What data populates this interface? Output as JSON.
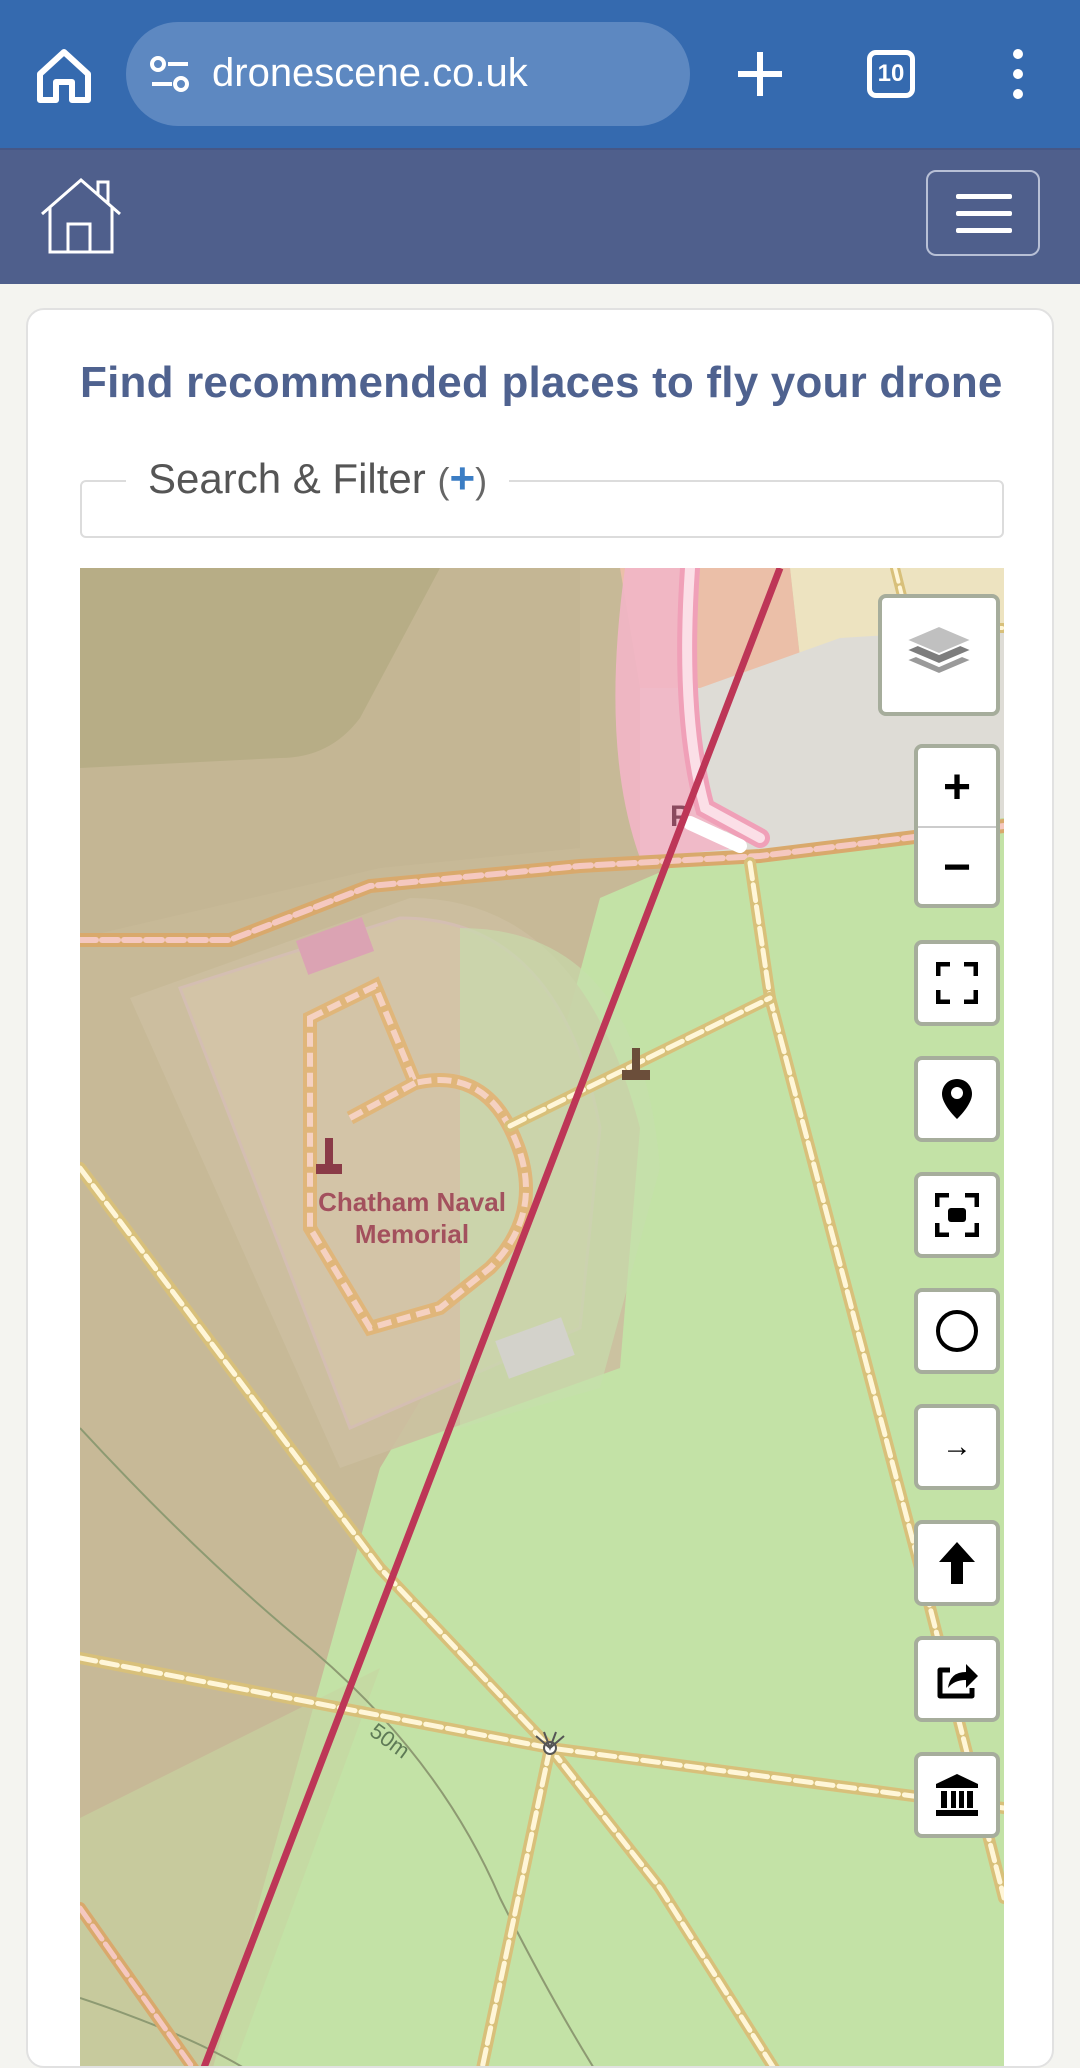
{
  "browser": {
    "url": "dronescene.co.uk",
    "tab_count": "10",
    "icons": [
      "home-icon",
      "site-settings-icon",
      "new-tab-icon",
      "tab-switcher-icon",
      "more-options-icon"
    ]
  },
  "site_nav": {
    "icons": [
      "home-outline-icon",
      "hamburger-menu-icon"
    ]
  },
  "page": {
    "title": "Find recommended places to fly your drone",
    "filter": {
      "label": "Search & Filter",
      "paren_open": "(",
      "toggle": "+",
      "paren_close": ")"
    }
  },
  "map": {
    "place_label_line1": "Chatham Naval",
    "place_label_line2": "Memorial",
    "contour_label": "50m",
    "parking_symbol": "P",
    "controls": {
      "zoom_in": "+",
      "zoom_out": "−",
      "nearby_arrow": "→",
      "icons": [
        "layers-icon",
        "fullscreen-icon",
        "location-pin-icon",
        "focus-icon",
        "circle-icon",
        "arrow-right-icon",
        "north-arrow-icon",
        "share-icon",
        "museum-icon"
      ]
    },
    "colors": {
      "flight_line": "#bd3657",
      "green_area": "#c3e2a6",
      "military_area": "#c6b898",
      "path_outline": "#e0b67a"
    }
  }
}
